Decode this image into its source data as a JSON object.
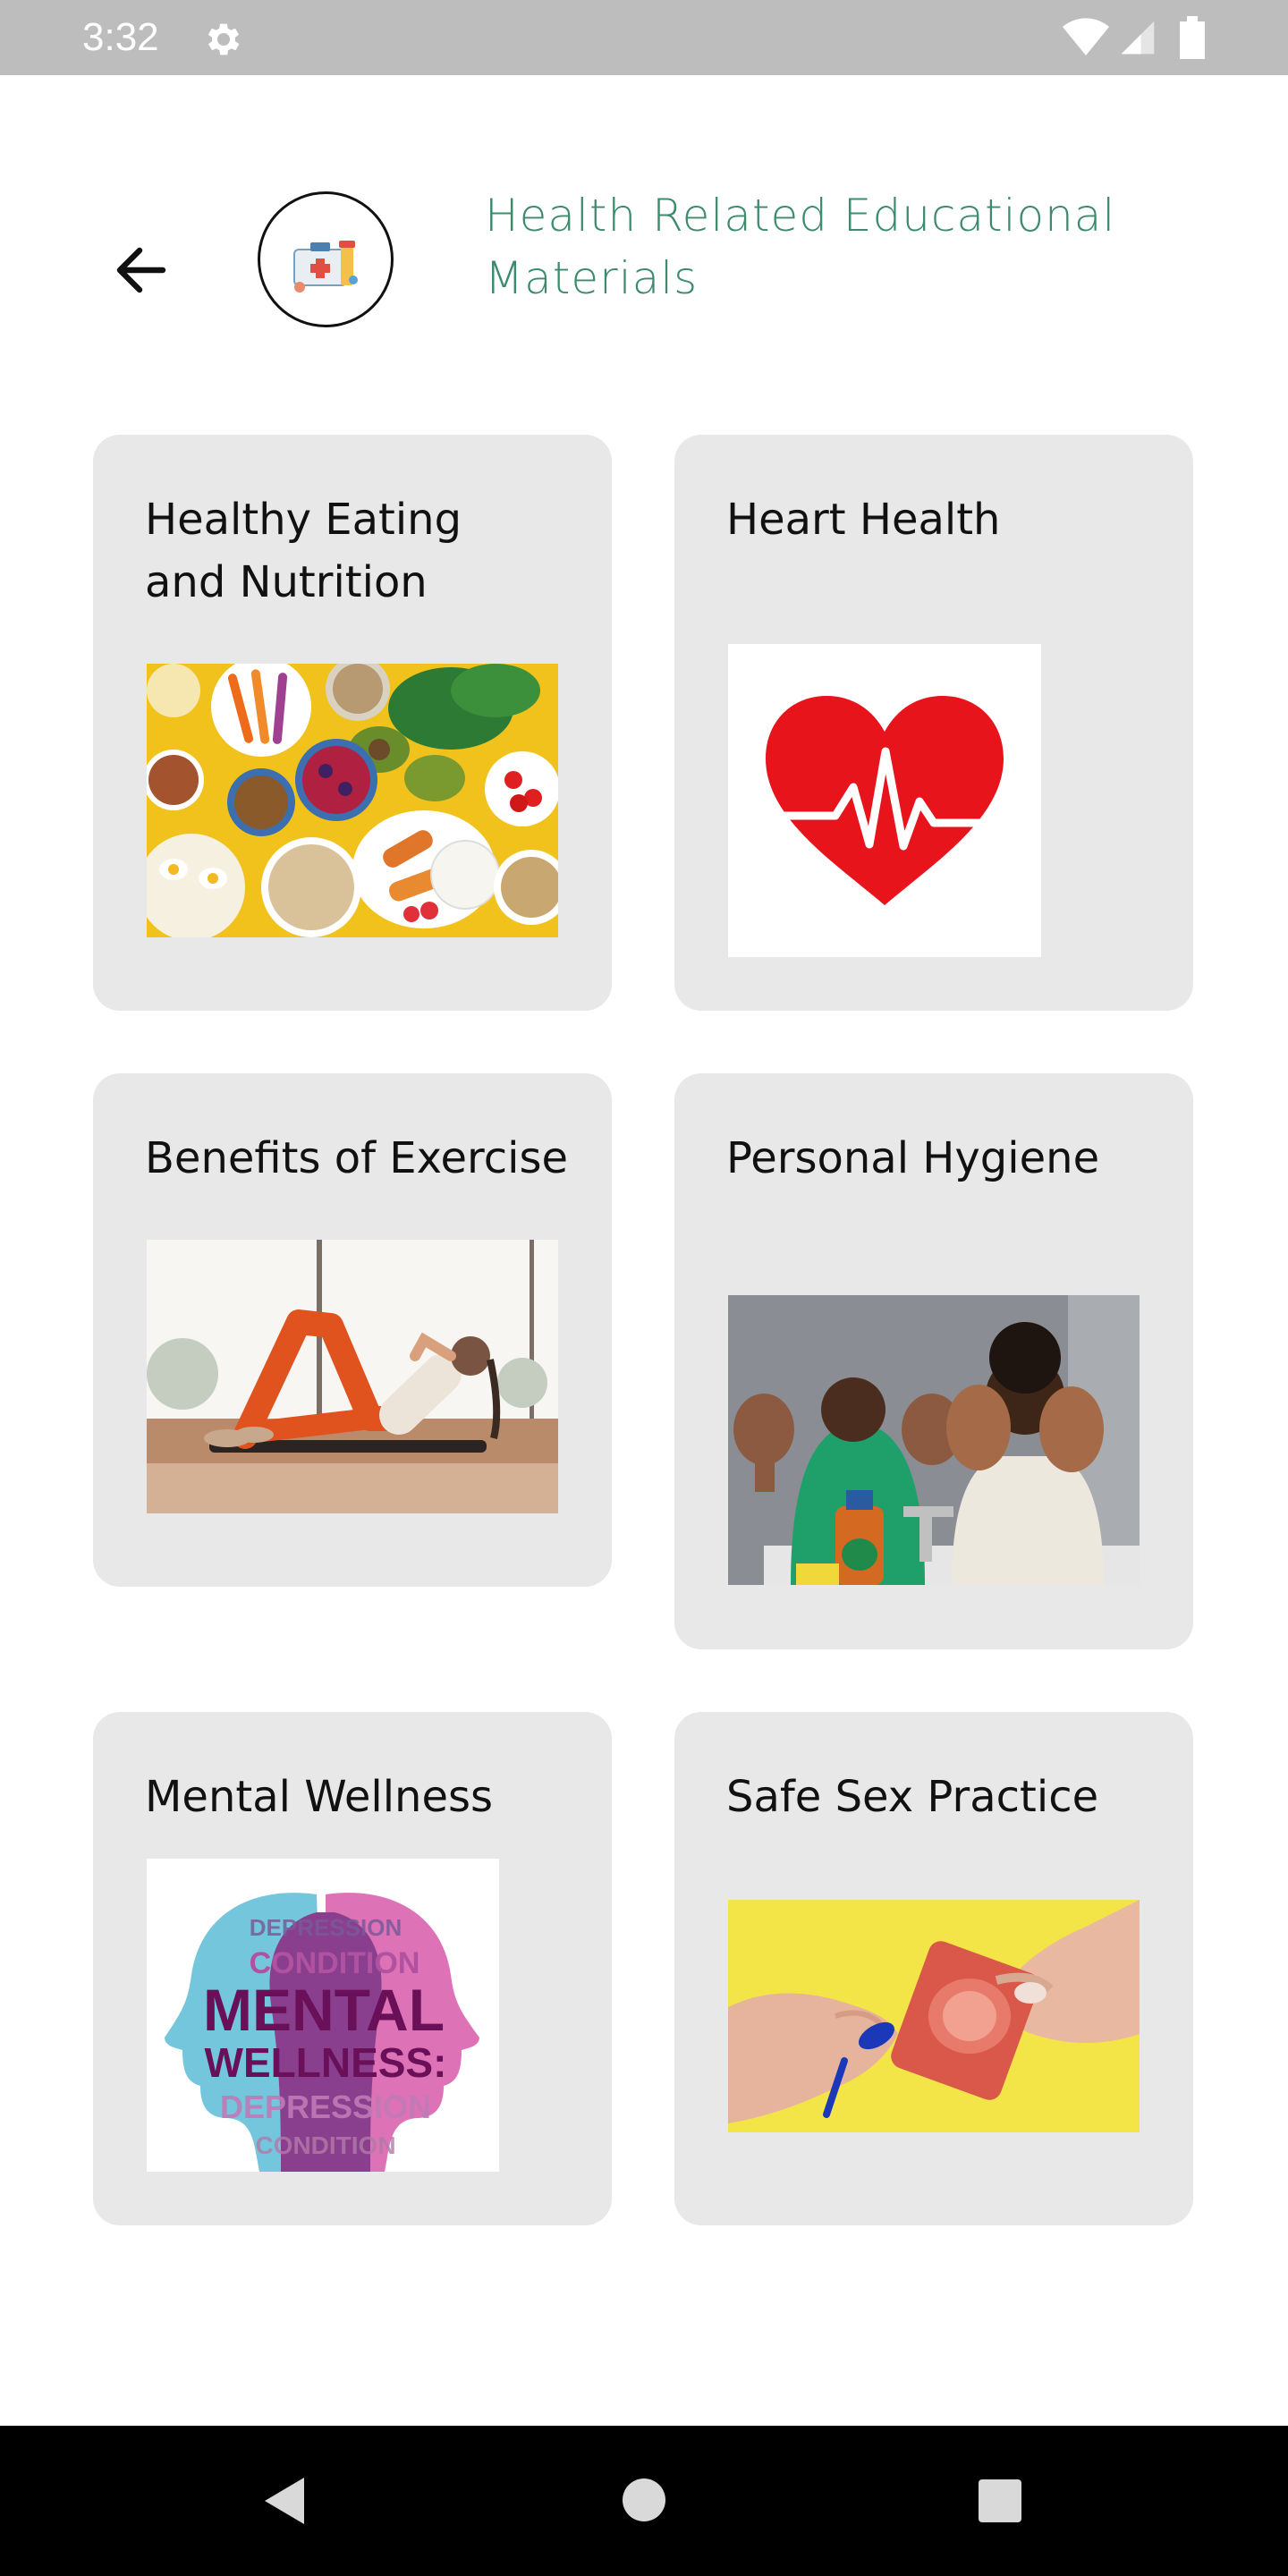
{
  "status_bar": {
    "time": "3:32",
    "icons": [
      "gear-icon",
      "wifi-icon",
      "signal-icon",
      "battery-icon"
    ]
  },
  "header": {
    "back_icon": "arrow-left-icon",
    "logo": "medical-kit-logo",
    "title": "Health Related Educational Materials"
  },
  "cards": [
    {
      "label": "Healthy Eating and Nutrition",
      "image": "food-bowls-image"
    },
    {
      "label": "Heart Health",
      "image": "heart-pulse-image"
    },
    {
      "label": "Benefits of Exercise",
      "image": "woman-situps-image"
    },
    {
      "label": "Personal Hygiene",
      "image": "handwashing-family-image"
    },
    {
      "label": "Mental Wellness",
      "image": "mental-wellness-heads-image",
      "image_text": {
        "word1": "MENTAL",
        "word2": "WELLNESS:",
        "word3": "DEPRESSION",
        "word4": "CONDITION"
      }
    },
    {
      "label": "Safe Sex Practice",
      "image": "condom-hands-image"
    }
  ],
  "nav_bar": {
    "icons": [
      "back-triangle-icon",
      "home-circle-icon",
      "recents-square-icon"
    ]
  },
  "colors": {
    "accent": "#3d8b6d",
    "card_bg": "#e8e8e8",
    "status_bar": "#bdbdbd"
  }
}
